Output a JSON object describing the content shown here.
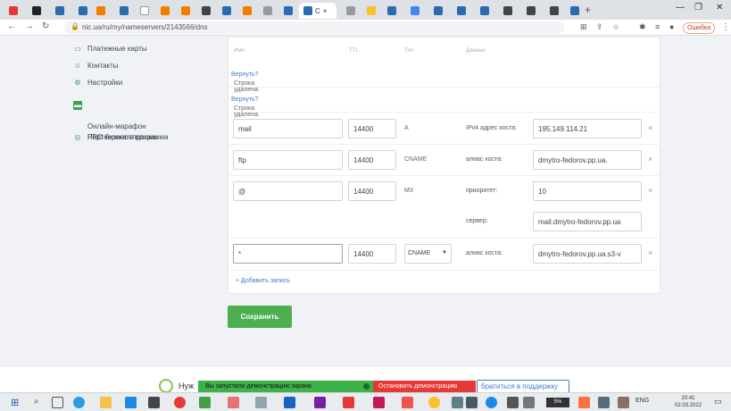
{
  "browser": {
    "active_tab_label": "C",
    "url": "nic.ua/ru/my/nameservers/2143566/dns",
    "error_button": "Ошибка"
  },
  "sidebar": {
    "items": [
      {
        "label": "Платежные карты",
        "icon": "card-icon"
      },
      {
        "label": "Контакты",
        "icon": "person-icon"
      },
      {
        "label": "Настройки",
        "icon": "gear-icon"
      },
      {
        "label": "Онлайн-марафон\nPRO бизнес в кризис",
        "icon": "marathon-icon"
      },
      {
        "label": "Партнерская программа",
        "icon": "partner-icon"
      }
    ]
  },
  "table": {
    "headers": {
      "name": "Имя",
      "ttl": "TTL",
      "type": "Тип",
      "data": "Данные"
    },
    "deleted_text": "Строка удалена.",
    "restore_link": "Вернуть?",
    "records": [
      {
        "name": "mail",
        "ttl": "14400",
        "type": "A",
        "data_label": "IPv4 адрес хоста:",
        "data_value": "195.149.114.21"
      },
      {
        "name": "ftp",
        "ttl": "14400",
        "type": "CNAME",
        "data_label": "алиас хоста:",
        "data_value": "dmytro-fedorov.pp.ua."
      },
      {
        "name": "@",
        "ttl": "14400",
        "type": "MX",
        "data_label": "приоритет:",
        "data_value": "10",
        "data_label2": "сервер:",
        "data_value2": "mail.dmytro-fedorov.pp.ua"
      },
      {
        "name": "*",
        "ttl": "14400",
        "type": "CNAME",
        "data_label": "алиас хоста:",
        "data_value": "dmytro-fedorov.pp.ua.s3-v"
      }
    ],
    "add_record": "+ Добавить запись",
    "delete_symbol": "×"
  },
  "save_button": "Сохранить",
  "footer": {
    "text": "Нуж",
    "support": "братиться в поддержку"
  },
  "demo": {
    "started": "Вы запустили демонстрацию экрана",
    "stop": "Остановить демонстрацию"
  },
  "taskbar": {
    "lang": "ENG",
    "time": "20:41",
    "date": "02.03.2022",
    "battery": "5%"
  },
  "colors": {
    "accent_green": "#4caf50",
    "link_blue": "#3b7fc4",
    "stop_red": "#e53935"
  }
}
